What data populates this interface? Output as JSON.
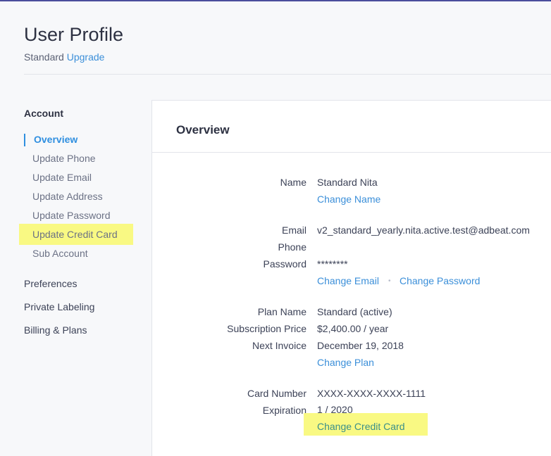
{
  "header": {
    "title": "User Profile",
    "plan": "Standard",
    "upgrade_label": "Upgrade"
  },
  "sidebar": {
    "account_heading": "Account",
    "items": [
      {
        "label": "Overview"
      },
      {
        "label": "Update Phone"
      },
      {
        "label": "Update Email"
      },
      {
        "label": "Update Address"
      },
      {
        "label": "Update Password"
      },
      {
        "label": "Update Credit Card"
      },
      {
        "label": "Sub Account"
      }
    ],
    "sections": [
      {
        "label": "Preferences"
      },
      {
        "label": "Private Labeling"
      },
      {
        "label": "Billing & Plans"
      }
    ]
  },
  "overview": {
    "title": "Overview",
    "name_label": "Name",
    "name_value": "Standard Nita",
    "change_name": "Change Name",
    "email_label": "Email",
    "email_value": "v2_standard_yearly.nita.active.test@adbeat.com",
    "phone_label": "Phone",
    "password_label": "Password",
    "password_value": "********",
    "change_email": "Change Email",
    "separator": "•",
    "change_password": "Change Password",
    "plan_name_label": "Plan Name",
    "plan_name_value": "Standard (active)",
    "subscription_price_label": "Subscription Price",
    "subscription_price_value": "$2,400.00 / year",
    "next_invoice_label": "Next Invoice",
    "next_invoice_value": "December 19, 2018",
    "change_plan": "Change Plan",
    "card_number_label": "Card Number",
    "card_number_value": "XXXX-XXXX-XXXX-1111",
    "expiration_label": "Expiration",
    "expiration_value": "1 / 2020",
    "change_credit_card": "Change Credit Card"
  },
  "colors": {
    "accent": "#2f8fe0",
    "link": "#3b8fd9",
    "highlight": "#f9f983"
  }
}
